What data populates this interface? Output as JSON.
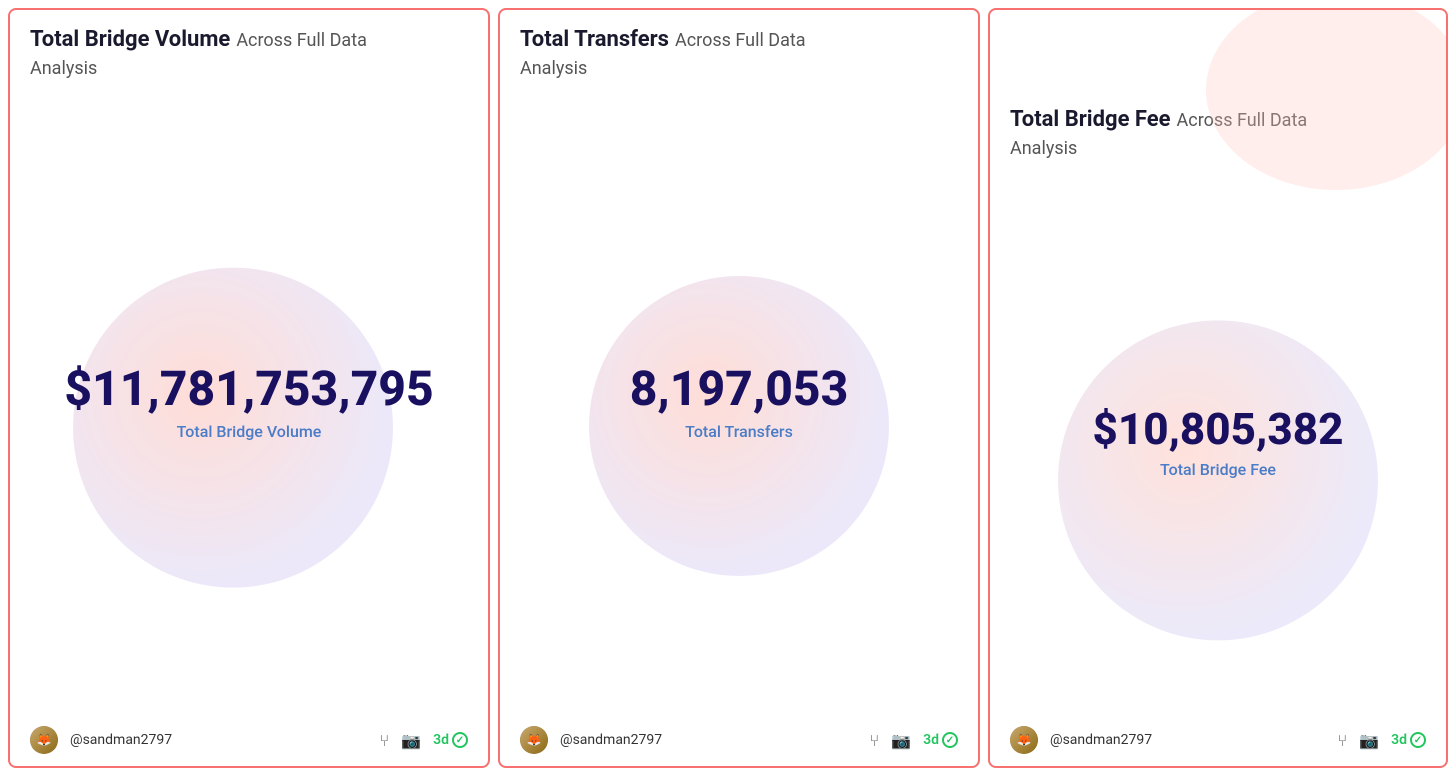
{
  "cards": [
    {
      "id": "total-bridge-volume",
      "title_main": "Total Bridge Volume",
      "title_sub": "Across Full Data",
      "title_sub2": "Analysis",
      "main_value": "$11,781,753,795",
      "value_label": "Total Bridge Volume",
      "username": "@sandman2797",
      "badge": "3d",
      "footer_icons": [
        "fork-icon",
        "camera-icon"
      ]
    },
    {
      "id": "total-transfers",
      "title_main": "Total Transfers",
      "title_sub": "Across Full Data",
      "title_sub2": "Analysis",
      "main_value": "8,197,053",
      "value_label": "Total Transfers",
      "username": "@sandman2797",
      "badge": "3d",
      "footer_icons": [
        "fork-icon",
        "camera-icon"
      ]
    },
    {
      "id": "total-bridge-fee",
      "title_main": "Total Bridge Fee",
      "title_sub": "Across Full Data",
      "title_sub2": "Analysis",
      "main_value": "$10,805,382",
      "value_label": "Total Bridge Fee",
      "username": "@sandman2797",
      "badge": "3d",
      "footer_icons": [
        "fork-icon",
        "camera-icon"
      ]
    }
  ],
  "colors": {
    "border": "#f87171",
    "title_main": "#1a1a2e",
    "value_main": "#1a1060",
    "value_label": "#4a7cc7",
    "badge": "#22c55e",
    "username": "#333"
  }
}
